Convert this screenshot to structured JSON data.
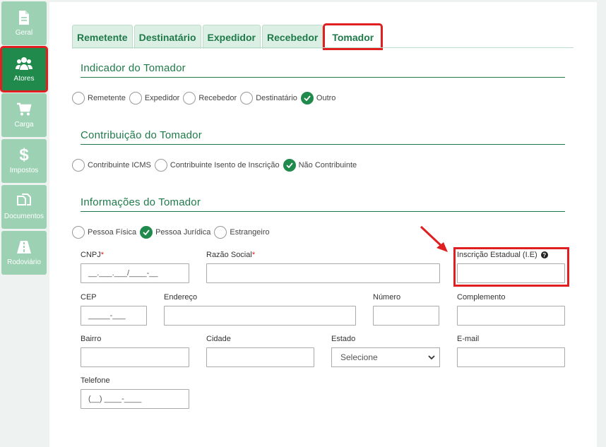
{
  "sidebar": {
    "items": [
      {
        "label": "Geral",
        "icon": "document-icon",
        "active": false
      },
      {
        "label": "Atores",
        "icon": "users-icon",
        "active": true
      },
      {
        "label": "Carga",
        "icon": "cart-icon",
        "active": false
      },
      {
        "label": "Impostos",
        "icon": "dollar-icon",
        "active": false
      },
      {
        "label": "Documentos",
        "icon": "documents-icon",
        "active": false
      },
      {
        "label": "Rodoviário",
        "icon": "road-icon",
        "active": false
      }
    ]
  },
  "tabs": [
    {
      "label": "Remetente",
      "active": false
    },
    {
      "label": "Destinatário",
      "active": false
    },
    {
      "label": "Expedidor",
      "active": false
    },
    {
      "label": "Recebedor",
      "active": false
    },
    {
      "label": "Tomador",
      "active": true
    }
  ],
  "indicador": {
    "title": "Indicador do Tomador",
    "options": [
      "Remetente",
      "Expedidor",
      "Recebedor",
      "Destinatário",
      "Outro"
    ],
    "selected": "Outro"
  },
  "contribuicao": {
    "title": "Contribuição do Tomador",
    "options": [
      "Contribuinte ICMS",
      "Contribuinte Isento de Inscrição",
      "Não Contribuinte"
    ],
    "selected": "Não Contribuinte"
  },
  "informacoes": {
    "title": "Informações do Tomador",
    "options": [
      "Pessoa Física",
      "Pessoa Jurídica",
      "Estrangeiro"
    ],
    "selected": "Pessoa Jurídica"
  },
  "fields": {
    "cnpj": {
      "label": "CNPJ",
      "required": "*",
      "mask": "__.___.___/____-__"
    },
    "razao": {
      "label": "Razão Social",
      "required": "*",
      "value": ""
    },
    "ie": {
      "label": "Inscrição Estadual (I.E)",
      "value": ""
    },
    "cep": {
      "label": "CEP",
      "mask": "_____-___"
    },
    "endereco": {
      "label": "Endereço",
      "value": ""
    },
    "numero": {
      "label": "Número",
      "value": ""
    },
    "complemento": {
      "label": "Complemento",
      "value": ""
    },
    "bairro": {
      "label": "Bairro",
      "value": ""
    },
    "cidade": {
      "label": "Cidade",
      "value": ""
    },
    "estado": {
      "label": "Estado",
      "selected": "Selecione"
    },
    "email": {
      "label": "E-mail",
      "value": ""
    },
    "telefone": {
      "label": "Telefone",
      "mask": "(__) ____-____"
    }
  },
  "colors": {
    "accent": "#1f8a4c",
    "sidebar": "#9dd1b4",
    "highlight": "#e02020"
  }
}
